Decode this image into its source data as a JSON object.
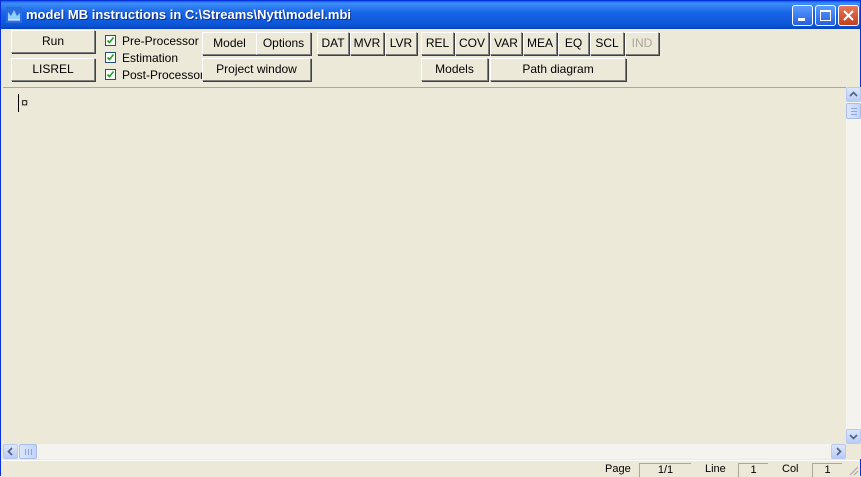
{
  "window": {
    "title": "model MB instructions in C:\\Streams\\Nytt\\model.mbi"
  },
  "toolbar": {
    "run_label": "Run",
    "lisrel_label": "LISREL",
    "checkboxes": [
      {
        "label": "Pre-Processor",
        "checked": true
      },
      {
        "label": "Estimation",
        "checked": true
      },
      {
        "label": "Post-Processor",
        "checked": true
      }
    ],
    "model_label": "Model",
    "options_label": "Options",
    "project_window_label": "Project window",
    "dat_label": "DAT",
    "mvr_label": "MVR",
    "lvr_label": "LVR",
    "rel_label": "REL",
    "cov_label": "COV",
    "var_label": "VAR",
    "mea_label": "MEA",
    "eq_label": "EQ",
    "scl_label": "SCL",
    "ind_label": "IND",
    "models_label": "Models",
    "path_diagram_label": "Path diagram"
  },
  "editor": {
    "content": "¤"
  },
  "status": {
    "page_label": "Page",
    "page_value": "1/1",
    "line_label": "Line",
    "line_value": "1",
    "col_label": "Col",
    "col_value": "1"
  },
  "colors": {
    "titlebar": "#0a55d6",
    "face": "#ece9d8",
    "disabled_text": "#aca899"
  }
}
